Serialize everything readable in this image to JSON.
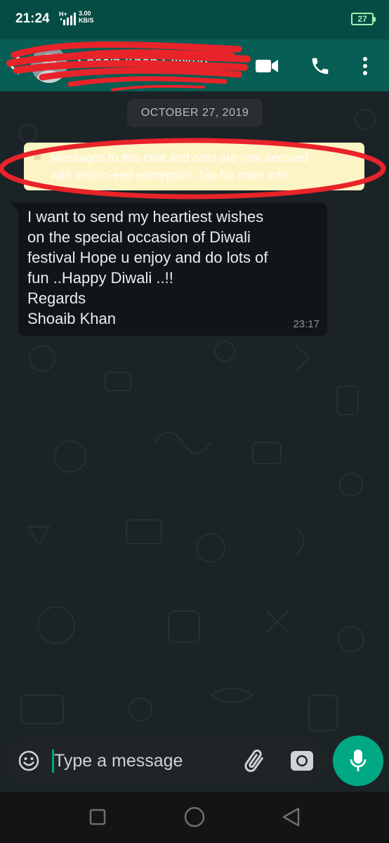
{
  "status_bar": {
    "time": "21:24",
    "network": "H+",
    "speed_value": "3.00",
    "speed_unit": "KB/S",
    "battery": "27"
  },
  "app_bar": {
    "contact_name": "Shoaib Khan Stickers",
    "icons": [
      "back-arrow-icon",
      "video-call-icon",
      "voice-call-icon",
      "more-options-icon"
    ]
  },
  "chat": {
    "date": "OCTOBER 27, 2019",
    "encryption_notice": {
      "line1": "Messages to this chat and calls are now secured",
      "line2": "with end-to-end encryption. Tap for more info."
    },
    "message": {
      "lines": [
        "I want to send my heartiest wishes",
        "on the special occasion of Diwali",
        "festival Hope u enjoy and do lots of",
        "fun ..Happy Diwali ..!!",
        "Regards",
        "Shoaib Khan"
      ],
      "time": "23:17"
    }
  },
  "input_bar": {
    "placeholder": "Type a message",
    "icons": [
      "emoji-icon",
      "attach-icon",
      "camera-icon",
      "microphone-icon"
    ]
  },
  "nav_bar": {
    "icons": [
      "recent-apps-icon",
      "home-icon",
      "back-icon"
    ]
  },
  "colors": {
    "header": "#075e54",
    "status_bar": "#054d44",
    "accent": "#00a884",
    "chat_background": "#1b2327",
    "bubble": "#121517",
    "encryption_banner": "#fdf4c5",
    "redaction": "#e8232a"
  }
}
